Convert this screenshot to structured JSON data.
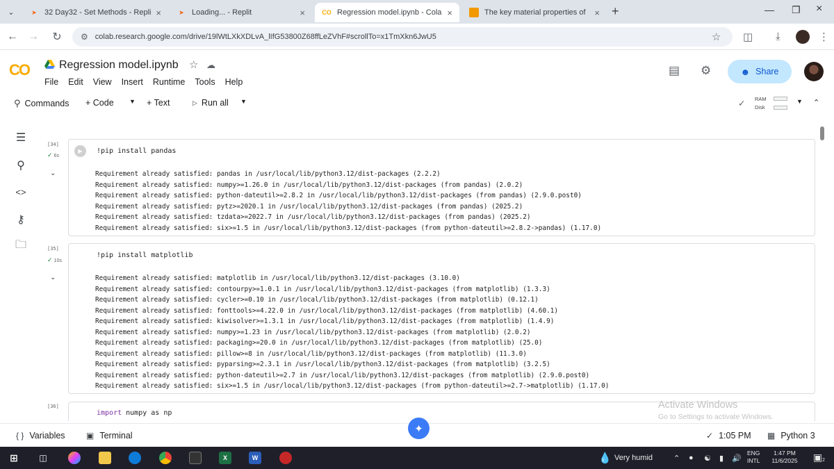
{
  "browser": {
    "tabs": [
      {
        "title": "32 Day32 - Set Methods - Repli",
        "favicon": "replit-icon",
        "active": false
      },
      {
        "title": "Loading... - Replit",
        "favicon": "replit-icon",
        "active": false
      },
      {
        "title": "Regression model.ipynb - Cola",
        "favicon": "colab-icon",
        "active": true
      },
      {
        "title": "The key material properties of",
        "favicon": "slides-icon",
        "active": false
      }
    ],
    "url": "colab.research.google.com/drive/19lWtLXkXDLvA_lIfG53800Z68ffLeZVhF#scrollTo=x1TmXkn6JwU5"
  },
  "colab": {
    "logo": "CO",
    "title": "Regression model.ipynb",
    "menu": [
      "File",
      "Edit",
      "View",
      "Insert",
      "Runtime",
      "Tools",
      "Help"
    ],
    "share_label": "Share",
    "toolbar": {
      "commands": "Commands",
      "code": "+ Code",
      "text": "+ Text",
      "run_all": "Run all",
      "ram_label": "RAM",
      "disk_label": "Disk"
    }
  },
  "cells": [
    {
      "exec_count": "[34]",
      "exec_time": "6s",
      "code": "!pip install pandas",
      "output": [
        "Requirement already satisfied: pandas in /usr/local/lib/python3.12/dist-packages (2.2.2)",
        "Requirement already satisfied: numpy>=1.26.0 in /usr/local/lib/python3.12/dist-packages (from pandas) (2.0.2)",
        "Requirement already satisfied: python-dateutil>=2.8.2 in /usr/local/lib/python3.12/dist-packages (from pandas) (2.9.0.post0)",
        "Requirement already satisfied: pytz>=2020.1 in /usr/local/lib/python3.12/dist-packages (from pandas) (2025.2)",
        "Requirement already satisfied: tzdata>=2022.7 in /usr/local/lib/python3.12/dist-packages (from pandas) (2025.2)",
        "Requirement already satisfied: six>=1.5 in /usr/local/lib/python3.12/dist-packages (from python-dateutil>=2.8.2->pandas) (1.17.0)"
      ]
    },
    {
      "exec_count": "[35]",
      "exec_time": "10s",
      "code": "!pip install matplotlib",
      "output": [
        "Requirement already satisfied: matplotlib in /usr/local/lib/python3.12/dist-packages (3.10.0)",
        "Requirement already satisfied: contourpy>=1.0.1 in /usr/local/lib/python3.12/dist-packages (from matplotlib) (1.3.3)",
        "Requirement already satisfied: cycler>=0.10 in /usr/local/lib/python3.12/dist-packages (from matplotlib) (0.12.1)",
        "Requirement already satisfied: fonttools>=4.22.0 in /usr/local/lib/python3.12/dist-packages (from matplotlib) (4.60.1)",
        "Requirement already satisfied: kiwisolver>=1.3.1 in /usr/local/lib/python3.12/dist-packages (from matplotlib) (1.4.9)",
        "Requirement already satisfied: numpy>=1.23 in /usr/local/lib/python3.12/dist-packages (from matplotlib) (2.0.2)",
        "Requirement already satisfied: packaging>=20.0 in /usr/local/lib/python3.12/dist-packages (from matplotlib) (25.0)",
        "Requirement already satisfied: pillow>=8 in /usr/local/lib/python3.12/dist-packages (from matplotlib) (11.3.0)",
        "Requirement already satisfied: pyparsing>=2.3.1 in /usr/local/lib/python3.12/dist-packages (from matplotlib) (3.2.5)",
        "Requirement already satisfied: python-dateutil>=2.7 in /usr/local/lib/python3.12/dist-packages (from matplotlib) (2.9.0.post0)",
        "Requirement already satisfied: six>=1.5 in /usr/local/lib/python3.12/dist-packages (from python-dateutil>=2.7->matplotlib) (1.17.0)"
      ]
    },
    {
      "exec_count": "[36]",
      "code_keyword": "import",
      "code_rest": " numpy as np"
    }
  ],
  "watermark": {
    "line1": "Activate Windows",
    "line2": "Go to Settings to activate Windows."
  },
  "footer": {
    "variables": "Variables",
    "terminal": "Terminal",
    "time": "1:05 PM",
    "runtime": "Python 3"
  },
  "taskbar": {
    "weather": "Very humid",
    "lang_top": "ENG",
    "lang_bottom": "INTL",
    "clock_time": "1:47 PM",
    "clock_date": "11/6/2025",
    "notifications": "2"
  },
  "colors": {
    "colab_orange": "#f9ab00",
    "share_bg": "#c2e7ff",
    "accent_blue": "#0b57d0",
    "taskbar_bg": "#1f1f2a"
  }
}
